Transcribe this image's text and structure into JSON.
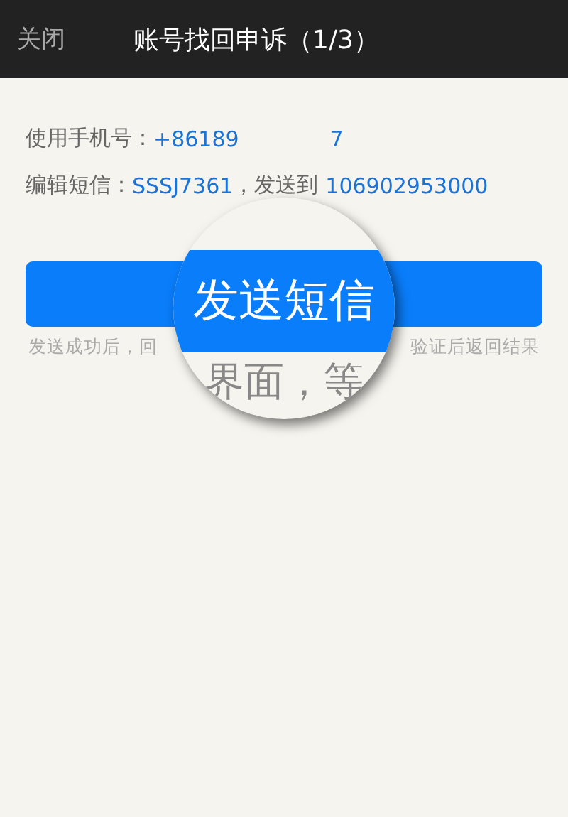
{
  "header": {
    "close": "关闭",
    "title": "账号找回申诉（1/3）"
  },
  "phone": {
    "label": "使用手机号：",
    "prefix": "+86189",
    "suffix": "7"
  },
  "sms": {
    "label": "编辑短信：",
    "code": "SSSJ7361",
    "middle": "，发送到",
    "number": "106902953000"
  },
  "hint": {
    "left": "发送成功后，回",
    "right": "验证后返回结果"
  },
  "magnifier": {
    "button_label": "发送短信",
    "text": "界面，等"
  }
}
